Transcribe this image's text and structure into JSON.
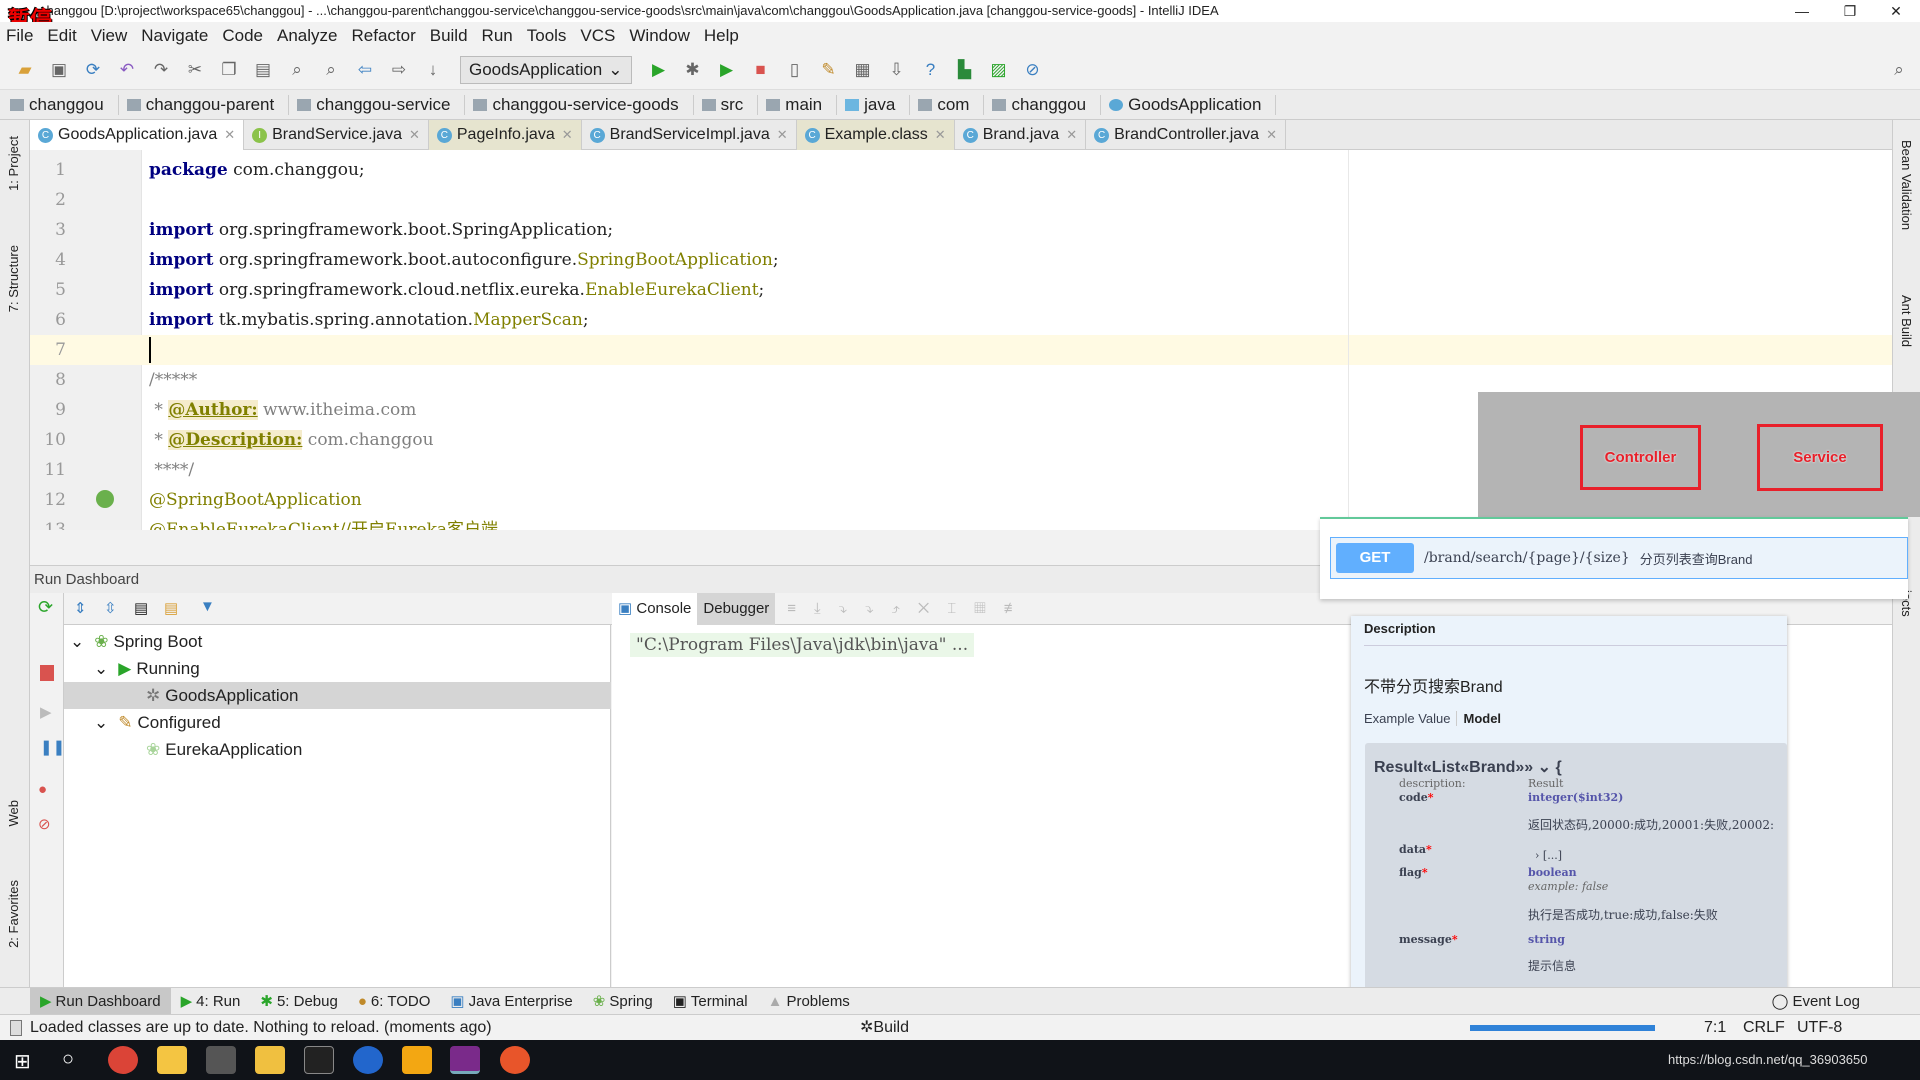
{
  "window": {
    "title": "changgou [D:\\project\\workspace65\\changgou] - ...\\changgou-parent\\changgou-service\\changgou-service-goods\\src\\main\\java\\com\\changgou\\GoodsApplication.java [changgou-service-goods] - IntelliJ IDEA",
    "overlay_label": "暂停"
  },
  "menu": [
    "File",
    "Edit",
    "View",
    "Navigate",
    "Code",
    "Analyze",
    "Refactor",
    "Build",
    "Run",
    "Tools",
    "VCS",
    "Window",
    "Help"
  ],
  "toolbar": {
    "run_config": "GoodsApplication"
  },
  "breadcrumbs": [
    "changgou",
    "changgou-parent",
    "changgou-service",
    "changgou-service-goods",
    "src",
    "main",
    "java",
    "com",
    "changgou",
    "GoodsApplication"
  ],
  "tabs": [
    {
      "label": "GoodsApplication.java",
      "icon": "C",
      "active": true
    },
    {
      "label": "BrandService.java",
      "icon": "I"
    },
    {
      "label": "PageInfo.java",
      "icon": "C"
    },
    {
      "label": "BrandServiceImpl.java",
      "icon": "C"
    },
    {
      "label": "Example.class",
      "icon": "C"
    },
    {
      "label": "Brand.java",
      "icon": "C"
    },
    {
      "label": "BrandController.java",
      "icon": "C"
    }
  ],
  "side_left": {
    "project": "1: Project",
    "structure": "7: Structure",
    "web": "Web",
    "favorites": "2: Favorites"
  },
  "side_right": {
    "bean": "Bean Validation",
    "ant": "Ant Build",
    "projects": "jects"
  },
  "editor": {
    "lines": [
      "1",
      "2",
      "3",
      "4",
      "5",
      "6",
      "7",
      "8",
      "9",
      "10",
      "11",
      "12",
      "13"
    ],
    "l1": {
      "kw": "package",
      "rest": " com.changgou;"
    },
    "l3": {
      "kw": "import",
      "rest": " org.springframework.boot.SpringApplication;"
    },
    "l4": {
      "kw": "import",
      "pkg": " org.springframework.boot.autoconfigure.",
      "cls": "SpringBootApplication",
      "end": ";"
    },
    "l5": {
      "kw": "import",
      "pkg": " org.springframework.cloud.netflix.eureka.",
      "cls": "EnableEurekaClient",
      "end": ";"
    },
    "l6": {
      "kw": "import",
      "pkg": " tk.mybatis.spring.annotation.",
      "cls": "MapperScan",
      "end": ";"
    },
    "l8": "/*****",
    "l9": {
      "star": " * ",
      "tag": "@Author:",
      "val": " www.itheima.com"
    },
    "l10": {
      "star": " * ",
      "tag": "@Description:",
      "val": " com.changgou"
    },
    "l11": " ****/",
    "l12": "@SpringBootApplication",
    "l13": "@EnableEurekaClient//开启Eureka客户端"
  },
  "run_dashboard": {
    "title": "Run Dashboard",
    "tree": [
      {
        "label": "Spring Boot"
      },
      {
        "label": "Running"
      },
      {
        "label": "GoodsApplication",
        "selected": true
      },
      {
        "label": "Configured"
      },
      {
        "label": "EurekaApplication"
      }
    ],
    "console_tab": "Console",
    "debugger_tab": "Debugger",
    "command": "\"C:\\Program Files\\Java\\jdk\\bin\\java\" ..."
  },
  "annotation_overlay": {
    "controller": "Controller",
    "service": "Service",
    "border_color": "#e8202a"
  },
  "swagger": {
    "method": "GET",
    "path": "/brand/search/{page}/{size}",
    "summary": "分页列表查询Brand",
    "description_header": "Description",
    "description": "不带分页搜索Brand",
    "example_tab": "Example Value",
    "model_tab": "Model",
    "model_title": "Result«List«Brand»»",
    "open_brace": "{",
    "close_brace": "}",
    "fields": {
      "description_key": "description:",
      "description_val": "Result",
      "code": "code",
      "code_type": "integer($int32)",
      "code_desc": "返回状态码,20000:成功,20001:失败,20002:",
      "data": "data",
      "data_val": "[...]",
      "flag": "flag",
      "flag_type": "boolean",
      "flag_example": "example: false",
      "flag_desc": "执行是否成功,true:成功,false:失败",
      "message": "message",
      "message_type": "string",
      "message_desc": "提示信息",
      "required_mark": "*"
    }
  },
  "tool_windows": [
    "Run Dashboard",
    "4: Run",
    "5: Debug",
    "6: TODO",
    "Java Enterprise",
    "Spring",
    "Terminal",
    "Problems"
  ],
  "event_log": "Event Log",
  "status": {
    "message": "Loaded classes are up to date. Nothing to reload. (moments ago)",
    "build": "Build",
    "position": "7:1",
    "line_sep": "CRLF",
    "encoding": "UTF-8"
  },
  "taskbar": {
    "tray": "https://blog.csdn.net/qq_36903650"
  }
}
